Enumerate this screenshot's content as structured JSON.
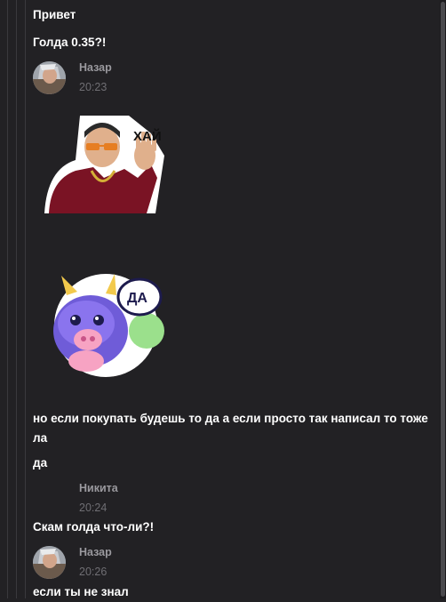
{
  "messages": {
    "m1": "Привет",
    "m2": "Голда 0.35?!",
    "m3": "но если покупать будешь то да а если просто так написал то тоже ла",
    "m4": "да",
    "m5": "Скам голда что-ли?!",
    "m6": "если ты не знал"
  },
  "authors": {
    "nazar": "Назар",
    "nikita": "Никита"
  },
  "times": {
    "t1": "20:23",
    "t2": "20:24",
    "t3": "20:26"
  },
  "stickers": {
    "hi_text": "ХАЙ",
    "yes_text": "ДА"
  },
  "colors": {
    "background": "#222124",
    "text": "#ffffff",
    "author": "#9a999e",
    "time": "#6f6e73"
  }
}
